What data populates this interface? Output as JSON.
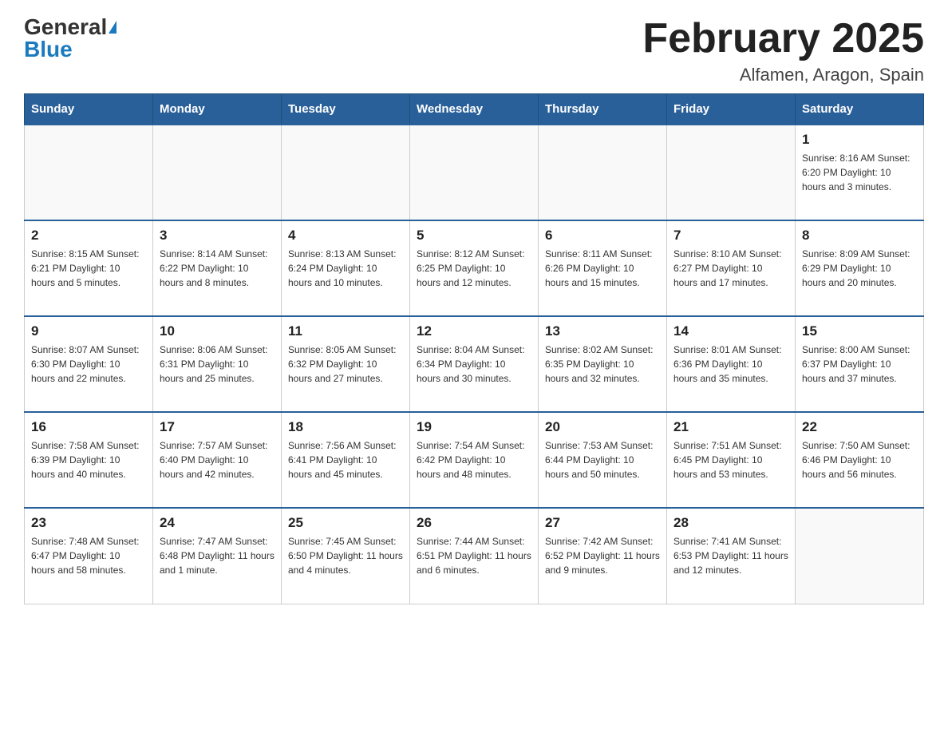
{
  "header": {
    "logo_general": "General",
    "logo_blue": "Blue",
    "month_title": "February 2025",
    "location": "Alfamen, Aragon, Spain"
  },
  "weekdays": [
    "Sunday",
    "Monday",
    "Tuesday",
    "Wednesday",
    "Thursday",
    "Friday",
    "Saturday"
  ],
  "weeks": [
    [
      {
        "day": "",
        "info": ""
      },
      {
        "day": "",
        "info": ""
      },
      {
        "day": "",
        "info": ""
      },
      {
        "day": "",
        "info": ""
      },
      {
        "day": "",
        "info": ""
      },
      {
        "day": "",
        "info": ""
      },
      {
        "day": "1",
        "info": "Sunrise: 8:16 AM\nSunset: 6:20 PM\nDaylight: 10 hours and 3 minutes."
      }
    ],
    [
      {
        "day": "2",
        "info": "Sunrise: 8:15 AM\nSunset: 6:21 PM\nDaylight: 10 hours and 5 minutes."
      },
      {
        "day": "3",
        "info": "Sunrise: 8:14 AM\nSunset: 6:22 PM\nDaylight: 10 hours and 8 minutes."
      },
      {
        "day": "4",
        "info": "Sunrise: 8:13 AM\nSunset: 6:24 PM\nDaylight: 10 hours and 10 minutes."
      },
      {
        "day": "5",
        "info": "Sunrise: 8:12 AM\nSunset: 6:25 PM\nDaylight: 10 hours and 12 minutes."
      },
      {
        "day": "6",
        "info": "Sunrise: 8:11 AM\nSunset: 6:26 PM\nDaylight: 10 hours and 15 minutes."
      },
      {
        "day": "7",
        "info": "Sunrise: 8:10 AM\nSunset: 6:27 PM\nDaylight: 10 hours and 17 minutes."
      },
      {
        "day": "8",
        "info": "Sunrise: 8:09 AM\nSunset: 6:29 PM\nDaylight: 10 hours and 20 minutes."
      }
    ],
    [
      {
        "day": "9",
        "info": "Sunrise: 8:07 AM\nSunset: 6:30 PM\nDaylight: 10 hours and 22 minutes."
      },
      {
        "day": "10",
        "info": "Sunrise: 8:06 AM\nSunset: 6:31 PM\nDaylight: 10 hours and 25 minutes."
      },
      {
        "day": "11",
        "info": "Sunrise: 8:05 AM\nSunset: 6:32 PM\nDaylight: 10 hours and 27 minutes."
      },
      {
        "day": "12",
        "info": "Sunrise: 8:04 AM\nSunset: 6:34 PM\nDaylight: 10 hours and 30 minutes."
      },
      {
        "day": "13",
        "info": "Sunrise: 8:02 AM\nSunset: 6:35 PM\nDaylight: 10 hours and 32 minutes."
      },
      {
        "day": "14",
        "info": "Sunrise: 8:01 AM\nSunset: 6:36 PM\nDaylight: 10 hours and 35 minutes."
      },
      {
        "day": "15",
        "info": "Sunrise: 8:00 AM\nSunset: 6:37 PM\nDaylight: 10 hours and 37 minutes."
      }
    ],
    [
      {
        "day": "16",
        "info": "Sunrise: 7:58 AM\nSunset: 6:39 PM\nDaylight: 10 hours and 40 minutes."
      },
      {
        "day": "17",
        "info": "Sunrise: 7:57 AM\nSunset: 6:40 PM\nDaylight: 10 hours and 42 minutes."
      },
      {
        "day": "18",
        "info": "Sunrise: 7:56 AM\nSunset: 6:41 PM\nDaylight: 10 hours and 45 minutes."
      },
      {
        "day": "19",
        "info": "Sunrise: 7:54 AM\nSunset: 6:42 PM\nDaylight: 10 hours and 48 minutes."
      },
      {
        "day": "20",
        "info": "Sunrise: 7:53 AM\nSunset: 6:44 PM\nDaylight: 10 hours and 50 minutes."
      },
      {
        "day": "21",
        "info": "Sunrise: 7:51 AM\nSunset: 6:45 PM\nDaylight: 10 hours and 53 minutes."
      },
      {
        "day": "22",
        "info": "Sunrise: 7:50 AM\nSunset: 6:46 PM\nDaylight: 10 hours and 56 minutes."
      }
    ],
    [
      {
        "day": "23",
        "info": "Sunrise: 7:48 AM\nSunset: 6:47 PM\nDaylight: 10 hours and 58 minutes."
      },
      {
        "day": "24",
        "info": "Sunrise: 7:47 AM\nSunset: 6:48 PM\nDaylight: 11 hours and 1 minute."
      },
      {
        "day": "25",
        "info": "Sunrise: 7:45 AM\nSunset: 6:50 PM\nDaylight: 11 hours and 4 minutes."
      },
      {
        "day": "26",
        "info": "Sunrise: 7:44 AM\nSunset: 6:51 PM\nDaylight: 11 hours and 6 minutes."
      },
      {
        "day": "27",
        "info": "Sunrise: 7:42 AM\nSunset: 6:52 PM\nDaylight: 11 hours and 9 minutes."
      },
      {
        "day": "28",
        "info": "Sunrise: 7:41 AM\nSunset: 6:53 PM\nDaylight: 11 hours and 12 minutes."
      },
      {
        "day": "",
        "info": ""
      }
    ]
  ]
}
